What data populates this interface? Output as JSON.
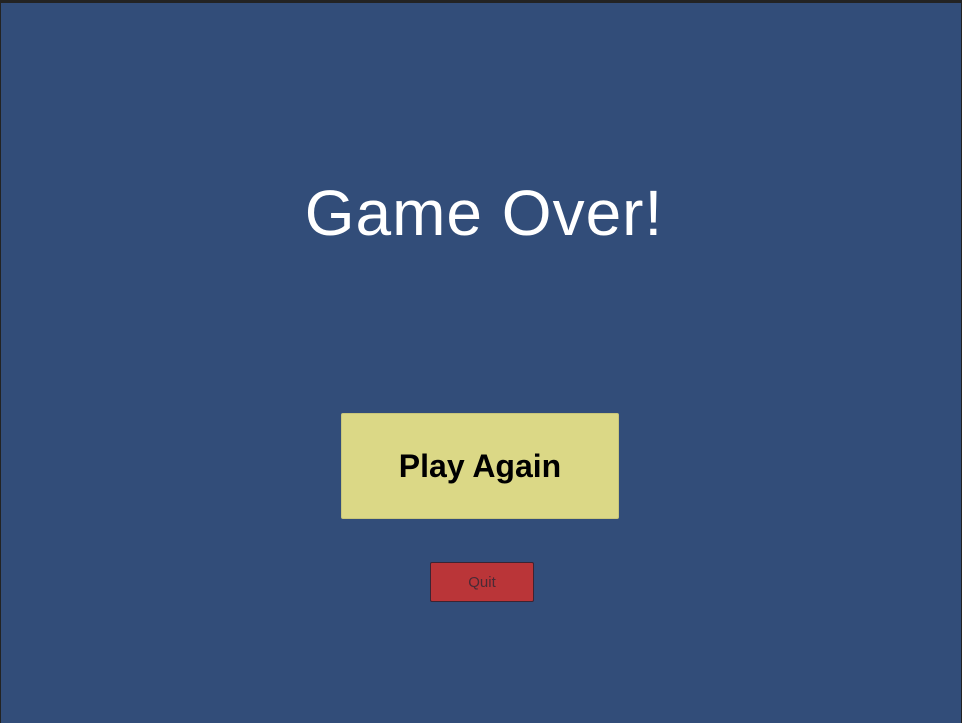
{
  "screen": {
    "title": "Game Over!",
    "background_color": "#324d79"
  },
  "buttons": {
    "play_again": {
      "label": "Play Again",
      "color": "#dbd886"
    },
    "quit": {
      "label": "Quit",
      "color": "#ba3538"
    }
  }
}
